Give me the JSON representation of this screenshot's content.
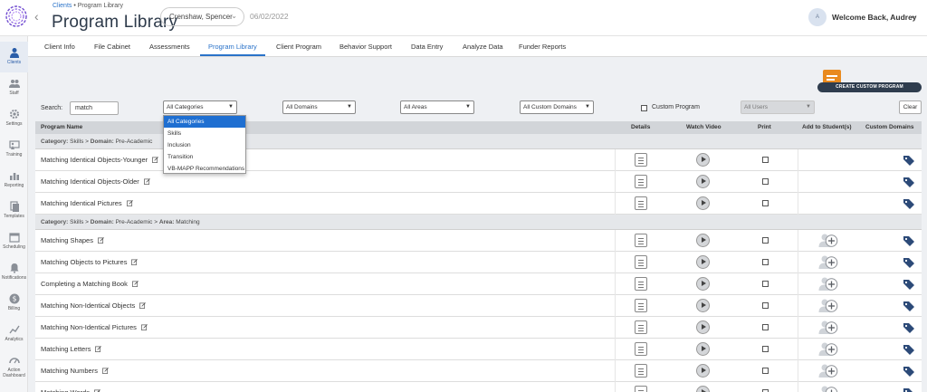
{
  "header": {
    "breadcrumb_link": "Clients",
    "breadcrumb_sep": "•",
    "breadcrumb_current": "Program Library",
    "title": "Program Library",
    "client_name": "Crenshaw, Spencer",
    "date": "06/02/2022",
    "avatar_initial": "A",
    "welcome": "Welcome Back, Audrey"
  },
  "sidebar": {
    "items": [
      {
        "label": "Clients",
        "icon": "person-icon"
      },
      {
        "label": "Staff",
        "icon": "group-icon"
      },
      {
        "label": "Settings",
        "icon": "gear-icon"
      },
      {
        "label": "Training",
        "icon": "training-icon"
      },
      {
        "label": "Reporting",
        "icon": "chart-icon"
      },
      {
        "label": "Templates",
        "icon": "templates-icon"
      },
      {
        "label": "Scheduling",
        "icon": "calendar-icon"
      },
      {
        "label": "Notifications",
        "icon": "bell-icon"
      },
      {
        "label": "Billing",
        "icon": "dollar-icon"
      },
      {
        "label": "Analytics",
        "icon": "analytics-icon"
      },
      {
        "label": "Action",
        "label2": "Dashboard",
        "icon": "dashboard-icon"
      }
    ]
  },
  "tabs": [
    "Client Info",
    "File Cabinet",
    "Assessments",
    "Program Library",
    "Client Program",
    "Behavior Support",
    "Data Entry",
    "Analyze Data",
    "Funder Reports"
  ],
  "toolbar": {
    "create_label": "CREATE CUSTOM PROGRAM",
    "search_label": "Search:",
    "search_value": "match",
    "category_selected": "All Categories",
    "domains_selected": "All Domains",
    "areas_selected": "All Areas",
    "custom_domains_selected": "All Custom Domains",
    "custom_program_label": "Custom Program",
    "users_selected": "All Users",
    "clear_label": "Clear"
  },
  "category_options": [
    "All Categories",
    "Skills",
    "Inclusion",
    "Transition",
    "VB-MAPP Recommendations"
  ],
  "table": {
    "headers": {
      "name": "Program Name",
      "details": "Details",
      "video": "Watch Video",
      "print": "Print",
      "add": "Add to Student(s)",
      "custom": "Custom Domains"
    },
    "group1": {
      "cat_label": "Category:",
      "cat_value": "Skills",
      "sep": ">",
      "dom_label": "Domain:",
      "dom_value": "Pre-Academic"
    },
    "group2": {
      "cat_label": "Category:",
      "cat_value": "Skills",
      "sep": ">",
      "dom_label": "Domain:",
      "dom_value": "Pre-Academic",
      "sep2": ">",
      "area_label": "Area:",
      "area_value": "Matching"
    },
    "rows_group1": [
      "Matching Identical Objects-Younger",
      "Matching Identical Objects-Older",
      "Matching Identical Pictures"
    ],
    "rows_group2": [
      "Matching Shapes",
      "Matching Objects to Pictures",
      "Completing a Matching Book",
      "Matching Non-Identical Objects",
      "Matching Non-Identical Pictures",
      "Matching Letters",
      "Matching Numbers",
      "Matching Words"
    ]
  },
  "colors": {
    "accent": "#2a73c9",
    "create_button": "#2f3d4e",
    "create_icon": "#e98a1e",
    "tag": "#2c4a78"
  }
}
